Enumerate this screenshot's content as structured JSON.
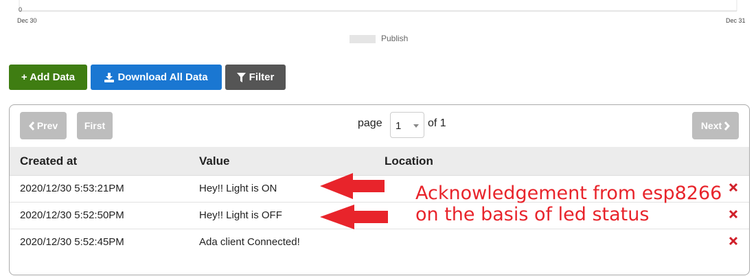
{
  "chart": {
    "y_tick": "0",
    "x_tick_start": "Dec 30",
    "x_tick_end": "Dec 31",
    "legend_label": "Publish",
    "legend_color": "#e5e5e5"
  },
  "toolbar": {
    "add_label": "+ Add Data",
    "download_label": "Download All Data",
    "filter_label": "Filter",
    "add_color": "#3f7d12",
    "download_color": "#1a77d2",
    "filter_color": "#555555"
  },
  "pager": {
    "prev_label": "Prev",
    "first_label": "First",
    "next_label": "Next",
    "page_label": "page",
    "current_page": "1",
    "of_label": "of 1"
  },
  "table": {
    "headers": [
      "Created at",
      "Value",
      "Location"
    ],
    "rows": [
      {
        "created": "2020/12/30 5:53:21PM",
        "value": "Hey!! Light is ON",
        "location": ""
      },
      {
        "created": "2020/12/30 5:52:50PM",
        "value": "Hey!! Light is OFF",
        "location": ""
      },
      {
        "created": "2020/12/30 5:52:45PM",
        "value": "Ada client Connected!",
        "location": ""
      }
    ]
  },
  "annotation": {
    "line1": "Acknowledgement from esp8266",
    "line2": "on the basis of led status",
    "color": "#e8242b"
  }
}
